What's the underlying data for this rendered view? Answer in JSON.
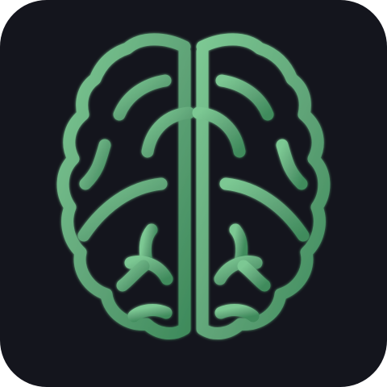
{
  "icon": {
    "name": "brain-icon",
    "background_color": "#14151d",
    "stroke_color": "#5fa377",
    "stroke_highlight": "#7cc893",
    "glow_color": "#3f8b5c"
  }
}
